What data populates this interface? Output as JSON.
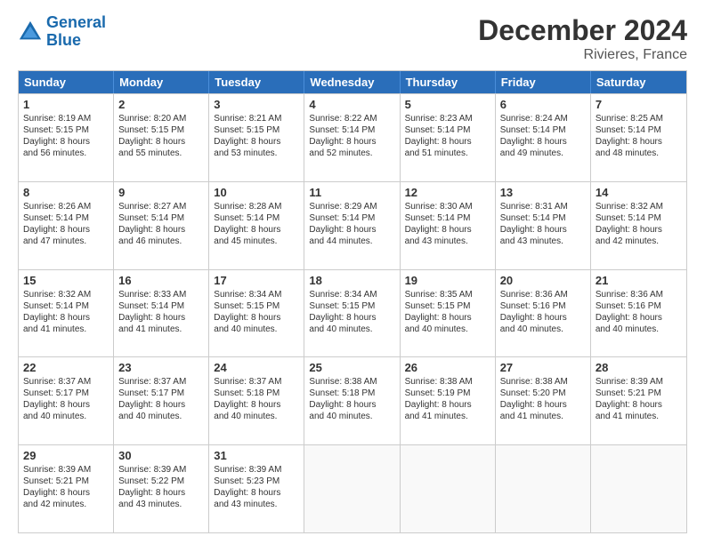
{
  "logo": {
    "text_general": "General",
    "text_blue": "Blue"
  },
  "header": {
    "title": "December 2024",
    "subtitle": "Rivieres, France"
  },
  "weekdays": [
    "Sunday",
    "Monday",
    "Tuesday",
    "Wednesday",
    "Thursday",
    "Friday",
    "Saturday"
  ],
  "weeks": [
    [
      {
        "day": "1",
        "lines": [
          "Sunrise: 8:19 AM",
          "Sunset: 5:15 PM",
          "Daylight: 8 hours",
          "and 56 minutes."
        ]
      },
      {
        "day": "2",
        "lines": [
          "Sunrise: 8:20 AM",
          "Sunset: 5:15 PM",
          "Daylight: 8 hours",
          "and 55 minutes."
        ]
      },
      {
        "day": "3",
        "lines": [
          "Sunrise: 8:21 AM",
          "Sunset: 5:15 PM",
          "Daylight: 8 hours",
          "and 53 minutes."
        ]
      },
      {
        "day": "4",
        "lines": [
          "Sunrise: 8:22 AM",
          "Sunset: 5:14 PM",
          "Daylight: 8 hours",
          "and 52 minutes."
        ]
      },
      {
        "day": "5",
        "lines": [
          "Sunrise: 8:23 AM",
          "Sunset: 5:14 PM",
          "Daylight: 8 hours",
          "and 51 minutes."
        ]
      },
      {
        "day": "6",
        "lines": [
          "Sunrise: 8:24 AM",
          "Sunset: 5:14 PM",
          "Daylight: 8 hours",
          "and 49 minutes."
        ]
      },
      {
        "day": "7",
        "lines": [
          "Sunrise: 8:25 AM",
          "Sunset: 5:14 PM",
          "Daylight: 8 hours",
          "and 48 minutes."
        ]
      }
    ],
    [
      {
        "day": "8",
        "lines": [
          "Sunrise: 8:26 AM",
          "Sunset: 5:14 PM",
          "Daylight: 8 hours",
          "and 47 minutes."
        ]
      },
      {
        "day": "9",
        "lines": [
          "Sunrise: 8:27 AM",
          "Sunset: 5:14 PM",
          "Daylight: 8 hours",
          "and 46 minutes."
        ]
      },
      {
        "day": "10",
        "lines": [
          "Sunrise: 8:28 AM",
          "Sunset: 5:14 PM",
          "Daylight: 8 hours",
          "and 45 minutes."
        ]
      },
      {
        "day": "11",
        "lines": [
          "Sunrise: 8:29 AM",
          "Sunset: 5:14 PM",
          "Daylight: 8 hours",
          "and 44 minutes."
        ]
      },
      {
        "day": "12",
        "lines": [
          "Sunrise: 8:30 AM",
          "Sunset: 5:14 PM",
          "Daylight: 8 hours",
          "and 43 minutes."
        ]
      },
      {
        "day": "13",
        "lines": [
          "Sunrise: 8:31 AM",
          "Sunset: 5:14 PM",
          "Daylight: 8 hours",
          "and 43 minutes."
        ]
      },
      {
        "day": "14",
        "lines": [
          "Sunrise: 8:32 AM",
          "Sunset: 5:14 PM",
          "Daylight: 8 hours",
          "and 42 minutes."
        ]
      }
    ],
    [
      {
        "day": "15",
        "lines": [
          "Sunrise: 8:32 AM",
          "Sunset: 5:14 PM",
          "Daylight: 8 hours",
          "and 41 minutes."
        ]
      },
      {
        "day": "16",
        "lines": [
          "Sunrise: 8:33 AM",
          "Sunset: 5:14 PM",
          "Daylight: 8 hours",
          "and 41 minutes."
        ]
      },
      {
        "day": "17",
        "lines": [
          "Sunrise: 8:34 AM",
          "Sunset: 5:15 PM",
          "Daylight: 8 hours",
          "and 40 minutes."
        ]
      },
      {
        "day": "18",
        "lines": [
          "Sunrise: 8:34 AM",
          "Sunset: 5:15 PM",
          "Daylight: 8 hours",
          "and 40 minutes."
        ]
      },
      {
        "day": "19",
        "lines": [
          "Sunrise: 8:35 AM",
          "Sunset: 5:15 PM",
          "Daylight: 8 hours",
          "and 40 minutes."
        ]
      },
      {
        "day": "20",
        "lines": [
          "Sunrise: 8:36 AM",
          "Sunset: 5:16 PM",
          "Daylight: 8 hours",
          "and 40 minutes."
        ]
      },
      {
        "day": "21",
        "lines": [
          "Sunrise: 8:36 AM",
          "Sunset: 5:16 PM",
          "Daylight: 8 hours",
          "and 40 minutes."
        ]
      }
    ],
    [
      {
        "day": "22",
        "lines": [
          "Sunrise: 8:37 AM",
          "Sunset: 5:17 PM",
          "Daylight: 8 hours",
          "and 40 minutes."
        ]
      },
      {
        "day": "23",
        "lines": [
          "Sunrise: 8:37 AM",
          "Sunset: 5:17 PM",
          "Daylight: 8 hours",
          "and 40 minutes."
        ]
      },
      {
        "day": "24",
        "lines": [
          "Sunrise: 8:37 AM",
          "Sunset: 5:18 PM",
          "Daylight: 8 hours",
          "and 40 minutes."
        ]
      },
      {
        "day": "25",
        "lines": [
          "Sunrise: 8:38 AM",
          "Sunset: 5:18 PM",
          "Daylight: 8 hours",
          "and 40 minutes."
        ]
      },
      {
        "day": "26",
        "lines": [
          "Sunrise: 8:38 AM",
          "Sunset: 5:19 PM",
          "Daylight: 8 hours",
          "and 41 minutes."
        ]
      },
      {
        "day": "27",
        "lines": [
          "Sunrise: 8:38 AM",
          "Sunset: 5:20 PM",
          "Daylight: 8 hours",
          "and 41 minutes."
        ]
      },
      {
        "day": "28",
        "lines": [
          "Sunrise: 8:39 AM",
          "Sunset: 5:21 PM",
          "Daylight: 8 hours",
          "and 41 minutes."
        ]
      }
    ],
    [
      {
        "day": "29",
        "lines": [
          "Sunrise: 8:39 AM",
          "Sunset: 5:21 PM",
          "Daylight: 8 hours",
          "and 42 minutes."
        ]
      },
      {
        "day": "30",
        "lines": [
          "Sunrise: 8:39 AM",
          "Sunset: 5:22 PM",
          "Daylight: 8 hours",
          "and 43 minutes."
        ]
      },
      {
        "day": "31",
        "lines": [
          "Sunrise: 8:39 AM",
          "Sunset: 5:23 PM",
          "Daylight: 8 hours",
          "and 43 minutes."
        ]
      },
      {
        "day": "",
        "lines": []
      },
      {
        "day": "",
        "lines": []
      },
      {
        "day": "",
        "lines": []
      },
      {
        "day": "",
        "lines": []
      }
    ]
  ]
}
